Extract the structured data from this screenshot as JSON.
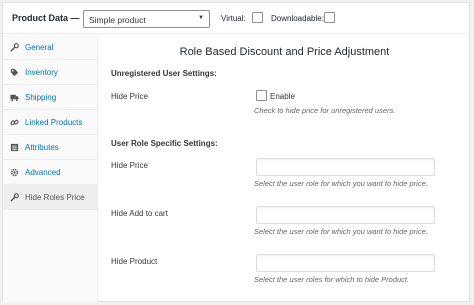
{
  "header": {
    "title": "Product Data",
    "dash": "—",
    "product_type": "Simple product",
    "virtual_label": "Virtual:",
    "downloadable_label": "Downloadable:"
  },
  "sidebar": {
    "items": [
      {
        "label": "General",
        "icon": "wrench-icon"
      },
      {
        "label": "Inventory",
        "icon": "tag-icon"
      },
      {
        "label": "Shipping",
        "icon": "truck-icon"
      },
      {
        "label": "Linked Products",
        "icon": "link-icon"
      },
      {
        "label": "Attributes",
        "icon": "list-icon"
      },
      {
        "label": "Advanced",
        "icon": "gear-icon"
      },
      {
        "label": "Hide Roles Price",
        "icon": "wrench-icon"
      }
    ],
    "active_index": 6
  },
  "main": {
    "title": "Role Based Discount and Price Adjustment",
    "unregistered": {
      "heading": "Unregistered User Settings:",
      "hide_price_label": "Hide Price",
      "enable_label": "Enable",
      "hide_price_desc": "Check to hide price for unregistered users."
    },
    "role_specific": {
      "heading": "User Role Specific Settings:",
      "fields": [
        {
          "label": "Hide Price",
          "desc": "Select the user role for which you want to hide price.",
          "value": ""
        },
        {
          "label": "Hide Add to cart",
          "desc": "Select the user role for which you want to hide price.",
          "value": ""
        },
        {
          "label": "Hide Product",
          "desc": "Select the user roles for which to hide Product.",
          "value": ""
        }
      ]
    }
  },
  "colors": {
    "link": "#0073aa",
    "active_tab_bg": "#eeeeee",
    "sidebar_bg": "#fafafa"
  }
}
